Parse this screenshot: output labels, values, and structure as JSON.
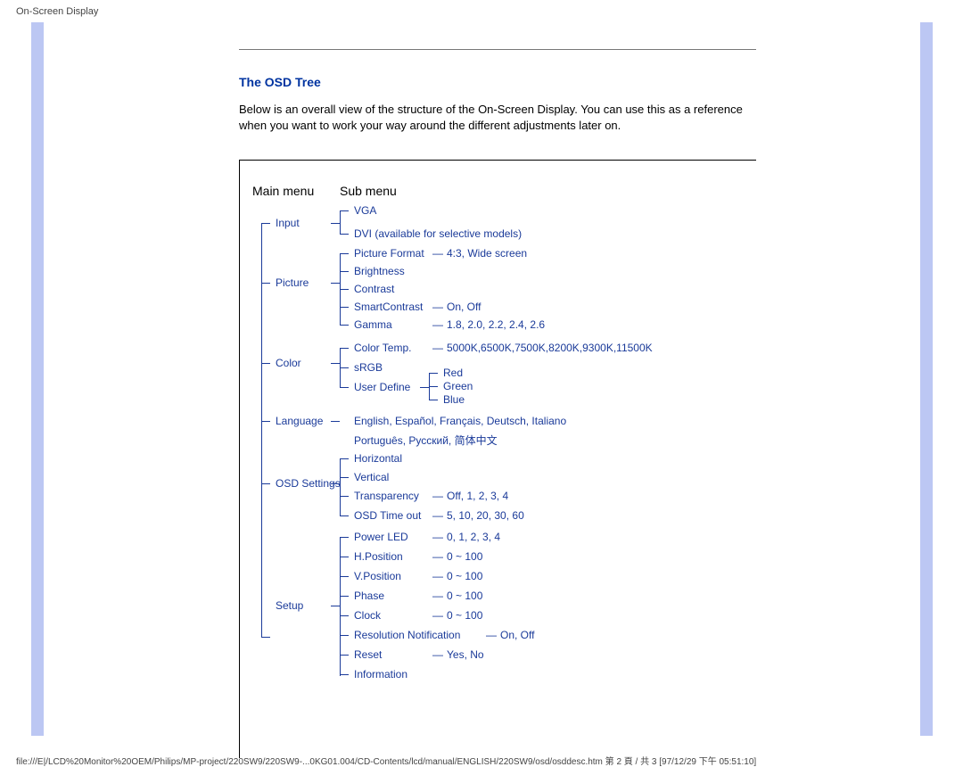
{
  "header": "On-Screen Display",
  "section_title": "The OSD Tree",
  "intro": "Below is an overall view of the structure of the On-Screen Display. You can use this as a reference when you want to work your way around the different adjustments later on.",
  "col_main": "Main menu",
  "col_sub": "Sub menu",
  "main": {
    "input": "Input",
    "picture": "Picture",
    "color": "Color",
    "language": "Language",
    "osd_settings": "OSD Settings",
    "setup": "Setup"
  },
  "sub": {
    "vga": "VGA",
    "dvi": "DVI (available for selective models)",
    "picture_format": "Picture Format",
    "brightness": "Brightness",
    "contrast": "Contrast",
    "smartcontrast": "SmartContrast",
    "gamma": "Gamma",
    "color_temp": "Color Temp.",
    "srgb": "sRGB",
    "user_define": "User Define",
    "lang_line1": "English, Español, Français, Deutsch, Italiano",
    "lang_line2": "Português, Русский, 简体中文",
    "horizontal": "Horizontal",
    "vertical": "Vertical",
    "transparency": "Transparency",
    "osd_timeout": "OSD Time out",
    "power_led": "Power LED",
    "h_position": "H.Position",
    "v_position": "V.Position",
    "phase": "Phase",
    "clock": "Clock",
    "res_notif": "Resolution Notification",
    "reset": "Reset",
    "information": "Information"
  },
  "opt": {
    "picture_format": "4:3, Wide screen",
    "smartcontrast": "On, Off",
    "gamma": "1.8, 2.0, 2.2, 2.4, 2.6",
    "color_temp": "5000K,6500K,7500K,8200K,9300K,11500K",
    "red": "Red",
    "green": "Green",
    "blue": "Blue",
    "transparency": "Off, 1, 2, 3, 4",
    "osd_timeout": "5, 10, 20, 30, 60",
    "power_led": "0, 1, 2, 3, 4",
    "h_position": "0 ~ 100",
    "v_position": "0 ~ 100",
    "phase": "0 ~ 100",
    "clock": "0 ~ 100",
    "res_notif": "On, Off",
    "reset": "Yes, No"
  },
  "dash": "—",
  "footer": "file:///E|/LCD%20Monitor%20OEM/Philips/MP-project/220SW9/220SW9-...0KG01.004/CD-Contents/lcd/manual/ENGLISH/220SW9/osd/osddesc.htm 第 2 頁 / 共 3  [97/12/29 下午 05:51:10]"
}
